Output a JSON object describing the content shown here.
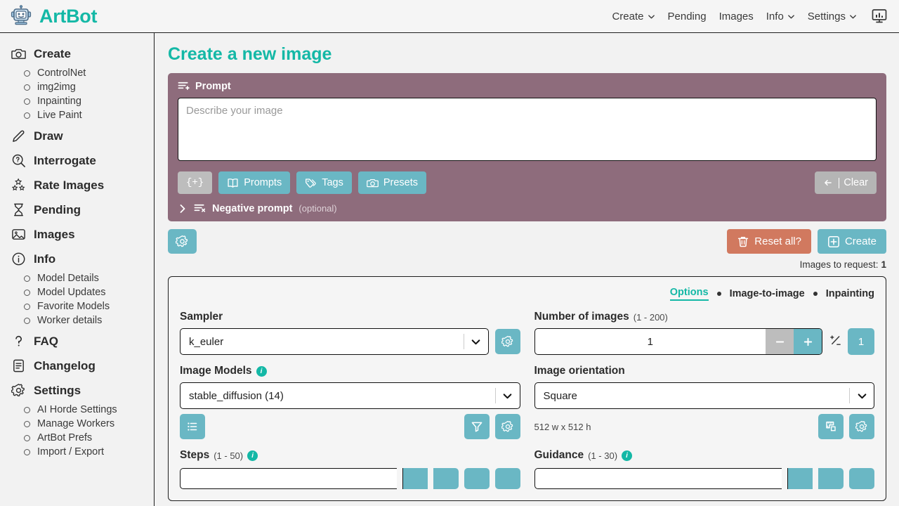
{
  "app": {
    "brand": "ArtBot",
    "logo_icon": "robot-icon"
  },
  "topnav": {
    "items": [
      {
        "label": "Create",
        "icon": "chevron-down-icon",
        "has_caret": true
      },
      {
        "label": "Pending",
        "has_caret": false
      },
      {
        "label": "Images",
        "has_caret": false
      },
      {
        "label": "Info",
        "icon": "chevron-down-icon",
        "has_caret": true
      },
      {
        "label": "Settings",
        "icon": "chevron-down-icon",
        "has_caret": true
      }
    ],
    "stats_button_icon": "monitor-stats-icon"
  },
  "sidebar": {
    "groups": [
      {
        "label": "Create",
        "icon": "camera-icon",
        "children": [
          {
            "label": "ControlNet"
          },
          {
            "label": "img2img"
          },
          {
            "label": "Inpainting"
          },
          {
            "label": "Live Paint"
          }
        ]
      },
      {
        "label": "Draw",
        "icon": "pencil-icon",
        "children": []
      },
      {
        "label": "Interrogate",
        "icon": "search-question-icon",
        "children": []
      },
      {
        "label": "Rate Images",
        "icon": "stars-icon",
        "children": []
      },
      {
        "label": "Pending",
        "icon": "hourglass-icon",
        "children": []
      },
      {
        "label": "Images",
        "icon": "photo-icon",
        "children": []
      },
      {
        "label": "Info",
        "icon": "info-circle-icon",
        "children": [
          {
            "label": "Model Details"
          },
          {
            "label": "Model Updates"
          },
          {
            "label": "Favorite Models"
          },
          {
            "label": "Worker details"
          }
        ]
      },
      {
        "label": "FAQ",
        "icon": "question-mark-icon",
        "children": []
      },
      {
        "label": "Changelog",
        "icon": "document-list-icon",
        "children": []
      },
      {
        "label": "Settings",
        "icon": "gear-icon",
        "children": [
          {
            "label": "AI Horde Settings"
          },
          {
            "label": "Manage Workers"
          },
          {
            "label": "ArtBot Prefs"
          },
          {
            "label": "Import / Export"
          }
        ]
      }
    ]
  },
  "main": {
    "page_title": "Create a new image",
    "prompt": {
      "label": "Prompt",
      "label_icon": "prompt-lines-plus-icon",
      "value": "",
      "placeholder": "Describe your image",
      "buttons": [
        {
          "id": "inject",
          "label": "{+}",
          "icon": null,
          "style": "grey"
        },
        {
          "id": "prompts",
          "label": "Prompts",
          "icon": "book-icon",
          "style": "teal"
        },
        {
          "id": "tags",
          "label": "Tags",
          "icon": "tags-icon",
          "style": "teal"
        },
        {
          "id": "presets",
          "label": "Presets",
          "icon": "camera-icon",
          "style": "teal"
        }
      ],
      "clear_label": "Clear",
      "clear_icon": "arrow-left-bar-icon",
      "negative": {
        "label": "Negative prompt",
        "optional": "(optional)",
        "chevron_icon": "chevron-right-icon",
        "icon": "prompt-lines-x-icon"
      }
    },
    "actions": {
      "settings_icon": "gear-icon",
      "reset_label": "Reset all?",
      "reset_icon": "trash-icon",
      "create_label": "Create",
      "create_icon": "plus-square-icon",
      "requests_label": "Images to request:",
      "requests_value": "1"
    },
    "options": {
      "tabs": [
        {
          "label": "Options",
          "active": true
        },
        {
          "label": "Image-to-image",
          "active": false
        },
        {
          "label": "Inpainting",
          "active": false
        }
      ],
      "sampler": {
        "label": "Sampler",
        "value": "k_euler",
        "caret_icon": "chevron-down-icon",
        "gear_icon": "gear-icon"
      },
      "number_of_images": {
        "label": "Number of images",
        "range": "(1 - 200)",
        "value": "1",
        "minus_icon": "minus-icon",
        "plus_icon": "plus-icon",
        "plusminus_icon": "plus-minus-icon",
        "chip_value": "1"
      },
      "image_models": {
        "label": "Image Models",
        "info_icon": "info-icon",
        "value": "stable_diffusion (14)",
        "caret_icon": "chevron-down-icon",
        "list_icon": "list-icon",
        "filter_icon": "funnel-icon",
        "gear_icon": "gear-icon"
      },
      "image_orientation": {
        "label": "Image orientation",
        "value": "Square",
        "caret_icon": "chevron-down-icon",
        "dimensions": "512 w x 512 h",
        "ruler_icon": "ruler-icon",
        "gear_icon": "gear-icon"
      },
      "steps": {
        "label": "Steps",
        "range": "(1 - 50)",
        "info_icon": "info-icon"
      },
      "guidance": {
        "label": "Guidance",
        "range": "(1 - 30)",
        "info_icon": "info-icon"
      }
    }
  },
  "colors": {
    "brand_teal": "#14b8a6",
    "button_teal": "#6ab7c4",
    "prompt_panel": "#8e6c7c",
    "reset_orange": "#d1795f",
    "grey_button": "#bdbdbd"
  }
}
